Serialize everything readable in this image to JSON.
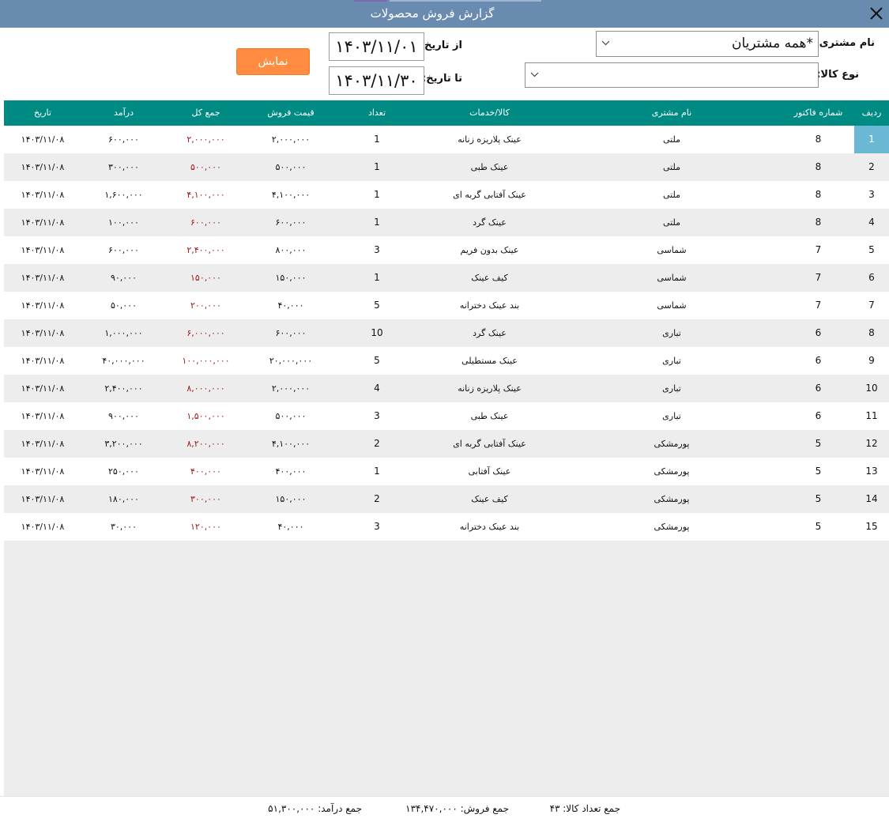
{
  "window": {
    "title": "گزارش فروش محصولات"
  },
  "filters": {
    "customer_label": "نام مشتری:",
    "customer_value": "*همه مشتریان",
    "product_label": "نوع کالا:",
    "product_value": "",
    "from_label": "از تاریخ:",
    "from_value": "۱۴۰۳/۱۱/۰۱",
    "to_label": "تا تاریخ:",
    "to_value": "۱۴۰۳/۱۱/۳۰",
    "show_button": "نمایش"
  },
  "table": {
    "columns": [
      "ردیف",
      "شماره فاکتور",
      "نام مشتری",
      "کالا/خدمات",
      "تعداد",
      "قیمت فروش",
      "جمع کل",
      "درآمد",
      "تاریخ"
    ],
    "selected_row": 0,
    "rows": [
      {
        "row": "1",
        "invoice": "8",
        "customer": "ملتی",
        "product": "عینک پلاریزه زنانه",
        "qty": "1",
        "price": "۲,۰۰۰,۰۰۰",
        "total": "۲,۰۰۰,۰۰۰",
        "income": "۶۰۰,۰۰۰",
        "date": "۱۴۰۳/۱۱/۰۸"
      },
      {
        "row": "2",
        "invoice": "8",
        "customer": "ملتی",
        "product": "عینک طبی",
        "qty": "1",
        "price": "۵۰۰,۰۰۰",
        "total": "۵۰۰,۰۰۰",
        "income": "۳۰۰,۰۰۰",
        "date": "۱۴۰۳/۱۱/۰۸"
      },
      {
        "row": "3",
        "invoice": "8",
        "customer": "ملتی",
        "product": "عینک آفتابی گربه ای",
        "qty": "1",
        "price": "۴,۱۰۰,۰۰۰",
        "total": "۴,۱۰۰,۰۰۰",
        "income": "۱,۶۰۰,۰۰۰",
        "date": "۱۴۰۳/۱۱/۰۸"
      },
      {
        "row": "4",
        "invoice": "8",
        "customer": "ملتی",
        "product": "عینک گرد",
        "qty": "1",
        "price": "۶۰۰,۰۰۰",
        "total": "۶۰۰,۰۰۰",
        "income": "۱۰۰,۰۰۰",
        "date": "۱۴۰۳/۱۱/۰۸"
      },
      {
        "row": "5",
        "invoice": "7",
        "customer": "شماسی",
        "product": "عینک بدون فریم",
        "qty": "3",
        "price": "۸۰۰,۰۰۰",
        "total": "۲,۴۰۰,۰۰۰",
        "income": "۶۰۰,۰۰۰",
        "date": "۱۴۰۳/۱۱/۰۸"
      },
      {
        "row": "6",
        "invoice": "7",
        "customer": "شماسی",
        "product": "کیف عینک",
        "qty": "1",
        "price": "۱۵۰,۰۰۰",
        "total": "۱۵۰,۰۰۰",
        "income": "۹۰,۰۰۰",
        "date": "۱۴۰۳/۱۱/۰۸"
      },
      {
        "row": "7",
        "invoice": "7",
        "customer": "شماسی",
        "product": "بند عینک دخترانه",
        "qty": "5",
        "price": "۴۰,۰۰۰",
        "total": "۲۰۰,۰۰۰",
        "income": "۵۰,۰۰۰",
        "date": "۱۴۰۳/۱۱/۰۸"
      },
      {
        "row": "8",
        "invoice": "6",
        "customer": "تباری",
        "product": "عینک گرد",
        "qty": "10",
        "price": "۶۰۰,۰۰۰",
        "total": "۶,۰۰۰,۰۰۰",
        "income": "۱,۰۰۰,۰۰۰",
        "date": "۱۴۰۳/۱۱/۰۸"
      },
      {
        "row": "9",
        "invoice": "6",
        "customer": "تباری",
        "product": "عینک مستطیلی",
        "qty": "5",
        "price": "۲۰,۰۰۰,۰۰۰",
        "total": "۱۰۰,۰۰۰,۰۰۰",
        "income": "۴۰,۰۰۰,۰۰۰",
        "date": "۱۴۰۳/۱۱/۰۸"
      },
      {
        "row": "10",
        "invoice": "6",
        "customer": "تباری",
        "product": "عینک پلاریزه زنانه",
        "qty": "4",
        "price": "۲,۰۰۰,۰۰۰",
        "total": "۸,۰۰۰,۰۰۰",
        "income": "۲,۴۰۰,۰۰۰",
        "date": "۱۴۰۳/۱۱/۰۸"
      },
      {
        "row": "11",
        "invoice": "6",
        "customer": "تباری",
        "product": "عینک طبی",
        "qty": "3",
        "price": "۵۰۰,۰۰۰",
        "total": "۱,۵۰۰,۰۰۰",
        "income": "۹۰۰,۰۰۰",
        "date": "۱۴۰۳/۱۱/۰۸"
      },
      {
        "row": "12",
        "invoice": "5",
        "customer": "پورمشکی",
        "product": "عینک آفتابی گربه ای",
        "qty": "2",
        "price": "۴,۱۰۰,۰۰۰",
        "total": "۸,۲۰۰,۰۰۰",
        "income": "۳,۲۰۰,۰۰۰",
        "date": "۱۴۰۳/۱۱/۰۸"
      },
      {
        "row": "13",
        "invoice": "5",
        "customer": "پورمشکی",
        "product": "عینک آفتابی",
        "qty": "1",
        "price": "۴۰۰,۰۰۰",
        "total": "۴۰۰,۰۰۰",
        "income": "۲۵۰,۰۰۰",
        "date": "۱۴۰۳/۱۱/۰۸"
      },
      {
        "row": "14",
        "invoice": "5",
        "customer": "پورمشکی",
        "product": "کیف عینک",
        "qty": "2",
        "price": "۱۵۰,۰۰۰",
        "total": "۳۰۰,۰۰۰",
        "income": "۱۸۰,۰۰۰",
        "date": "۱۴۰۳/۱۱/۰۸"
      },
      {
        "row": "15",
        "invoice": "5",
        "customer": "پورمشکی",
        "product": "بند عینک دخترانه",
        "qty": "3",
        "price": "۴۰,۰۰۰",
        "total": "۱۲۰,۰۰۰",
        "income": "۳۰,۰۰۰",
        "date": "۱۴۰۳/۱۱/۰۸"
      }
    ]
  },
  "footer": {
    "qty_total": "جمع تعداد کالا: ۴۳",
    "sales_total": "جمع فروش: ۱۳۴,۴۷۰,۰۰۰",
    "income_total": "جمع درآمد: ۵۱,۳۰۰,۰۰۰"
  },
  "colors": {
    "titlebar": "#6a8bb0",
    "header": "#008a84",
    "button": "#ff8c40",
    "total_text": "#a01818",
    "selected_cell": "#6ab8d3"
  }
}
